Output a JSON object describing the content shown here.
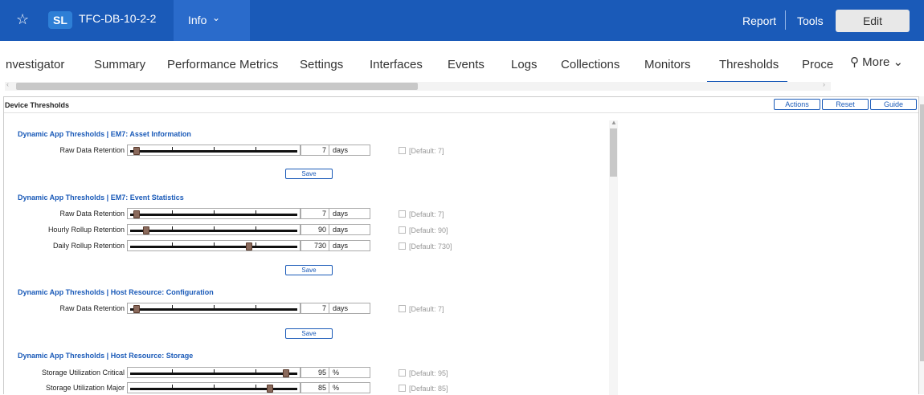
{
  "topbar": {
    "star_icon": "star-outline-icon",
    "logo_text": "SL",
    "device_name": "TFC-DB-10-2-2",
    "info_label": "Info",
    "report_label": "Report",
    "tools_label": "Tools",
    "edit_label": "Edit",
    "bar_color": "#1a5ab8"
  },
  "tabs": [
    {
      "label": "nvestigator"
    },
    {
      "label": "Summary"
    },
    {
      "label": "Performance Metrics"
    },
    {
      "label": "Settings"
    },
    {
      "label": "Interfaces"
    },
    {
      "label": "Events"
    },
    {
      "label": "Logs"
    },
    {
      "label": "Collections"
    },
    {
      "label": "Monitors"
    },
    {
      "label": "Thresholds",
      "active": true
    },
    {
      "label": "Proce"
    }
  ],
  "more_label": "More",
  "panel": {
    "title": "Device Thresholds",
    "actions_label": "Actions",
    "reset_label": "Reset",
    "guide_label": "Guide"
  },
  "sections": [
    {
      "title": "Dynamic App Thresholds | EM7: Asset Information",
      "save_label": "Save",
      "rows": [
        {
          "label": "Raw Data Retention",
          "value": "7",
          "unit": "days",
          "default": "[Default: 7]",
          "level": 0.02
        }
      ]
    },
    {
      "title": "Dynamic App Thresholds | EM7: Event Statistics",
      "save_label": "Save",
      "rows": [
        {
          "label": "Raw Data Retention",
          "value": "7",
          "unit": "days",
          "default": "[Default: 7]",
          "level": 0.02
        },
        {
          "label": "Hourly Rollup Retention",
          "value": "90",
          "unit": "days",
          "default": "[Default: 90]",
          "level": 0.08
        },
        {
          "label": "Daily Rollup Retention",
          "value": "730",
          "unit": "days",
          "default": "[Default: 730]",
          "level": 0.72
        }
      ]
    },
    {
      "title": "Dynamic App Thresholds | Host Resource: Configuration",
      "save_label": "Save",
      "rows": [
        {
          "label": "Raw Data Retention",
          "value": "7",
          "unit": "days",
          "default": "[Default: 7]",
          "level": 0.02
        }
      ]
    },
    {
      "title": "Dynamic App Thresholds | Host Resource: Storage",
      "rows": [
        {
          "label": "Storage Utilization Critical",
          "value": "95",
          "unit": "%",
          "default": "[Default: 95]",
          "level": 0.95
        },
        {
          "label": "Storage Utilization Major",
          "value": "85",
          "unit": "%",
          "default": "[Default: 85]",
          "level": 0.85
        }
      ]
    }
  ]
}
